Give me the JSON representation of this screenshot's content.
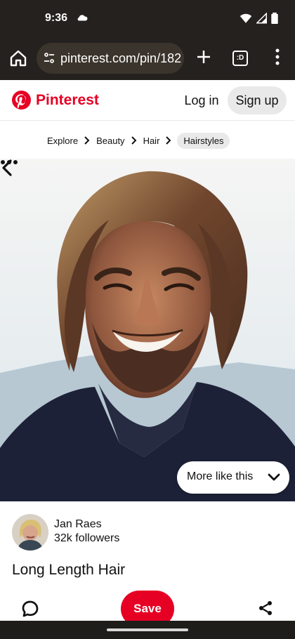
{
  "status_bar": {
    "time": "9:36",
    "icons": [
      "cloud-icon",
      "wifi-icon",
      "signal-icon",
      "battery-icon"
    ]
  },
  "browser": {
    "url": "pinterest.com/pin/182",
    "tabs_label": ":D",
    "icons": [
      "home-icon",
      "site-info-icon",
      "add-icon",
      "tabs-icon",
      "menu-dots-icon"
    ]
  },
  "header": {
    "brand": "Pinterest",
    "login_label": "Log in",
    "signup_label": "Sign up",
    "brand_color": "#e60023"
  },
  "breadcrumb": {
    "items": [
      "Explore",
      "Beauty",
      "Hair"
    ],
    "current": "Hairstyles"
  },
  "pin": {
    "more_like_label": "More like this",
    "creator_name": "Jan Raes",
    "creator_followers": "32k followers",
    "title": "Long Length Hair"
  },
  "actions": {
    "save_label": "Save",
    "save_color": "#e60023",
    "icons": [
      "comment-icon",
      "share-icon"
    ]
  },
  "colors": {
    "chrome_dark": "#24211e",
    "url_pill": "#3b342c",
    "light_button": "#e9e9e9"
  }
}
